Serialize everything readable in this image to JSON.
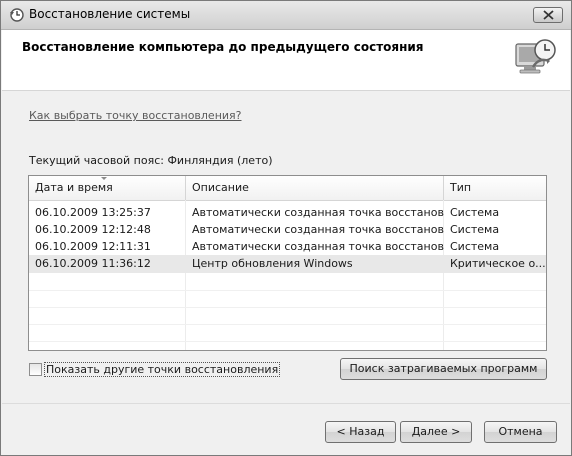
{
  "window": {
    "title": "Восстановление системы"
  },
  "header": {
    "title": "Восстановление компьютера до предыдущего состояния"
  },
  "help_link": "Как выбрать точку восстановления?",
  "timezone_line": "Текущий часовой пояс: Финляндия (лето)",
  "table": {
    "columns": [
      "Дата и время",
      "Описание",
      "Тип"
    ],
    "rows": [
      {
        "date": "06.10.2009 13:25:37",
        "description": "Автоматически созданная точка восстановле...",
        "type": "Система"
      },
      {
        "date": "06.10.2009 12:12:48",
        "description": "Автоматически созданная точка восстановле...",
        "type": "Система"
      },
      {
        "date": "06.10.2009 12:11:31",
        "description": "Автоматически созданная точка восстановле...",
        "type": "Система"
      },
      {
        "date": "06.10.2009 11:36:12",
        "description": "Центр обновления Windows",
        "type": "Критическое о..."
      }
    ],
    "selected_row": 3
  },
  "show_more_checkbox": {
    "label": "Показать другие точки восстановления",
    "checked": false
  },
  "buttons": {
    "scan": "Поиск затрагиваемых программ",
    "back": "< Назад",
    "next": "Далее >",
    "cancel": "Отмена"
  }
}
